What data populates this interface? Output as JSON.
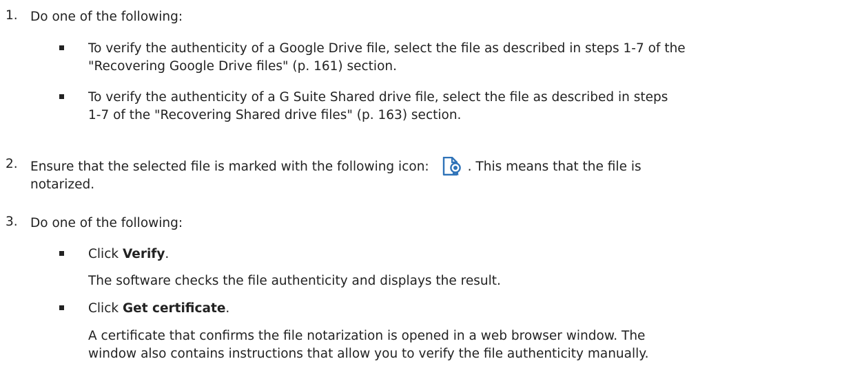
{
  "steps": [
    {
      "number": "1.",
      "text": "Do one of the following:",
      "bullets": [
        {
          "line1": "To verify the authenticity of a Google Drive file, select the file as described in steps 1-7 of the",
          "line2": "\"Recovering Google Drive files\" (p. 161) section."
        },
        {
          "line1": "To verify the authenticity of a G Suite Shared drive file, select the file as described in steps",
          "line2": "1-7 of the \"Recovering Shared drive files\" (p. 163) section."
        }
      ]
    },
    {
      "number": "2.",
      "text_before": "Ensure that the selected file is marked with the following icon:",
      "icon": "notarized-file-icon",
      "text_after": ". This means that the file is",
      "line2": "notarized."
    },
    {
      "number": "3.",
      "text": "Do one of the following:",
      "bullets": [
        {
          "prefix": "Click ",
          "bold": "Verify",
          "suffix": ".",
          "detail": "The software checks the file authenticity and displays the result."
        },
        {
          "prefix": "Click ",
          "bold": "Get certificate",
          "suffix": ".",
          "detail_line1": "A certificate that confirms the file notarization is opened in a web browser window. The",
          "detail_line2": "window also contains instructions that allow you to verify the file authenticity manually."
        }
      ]
    }
  ],
  "colors": {
    "text": "#222222",
    "icon_blue": "#2f73b8"
  }
}
